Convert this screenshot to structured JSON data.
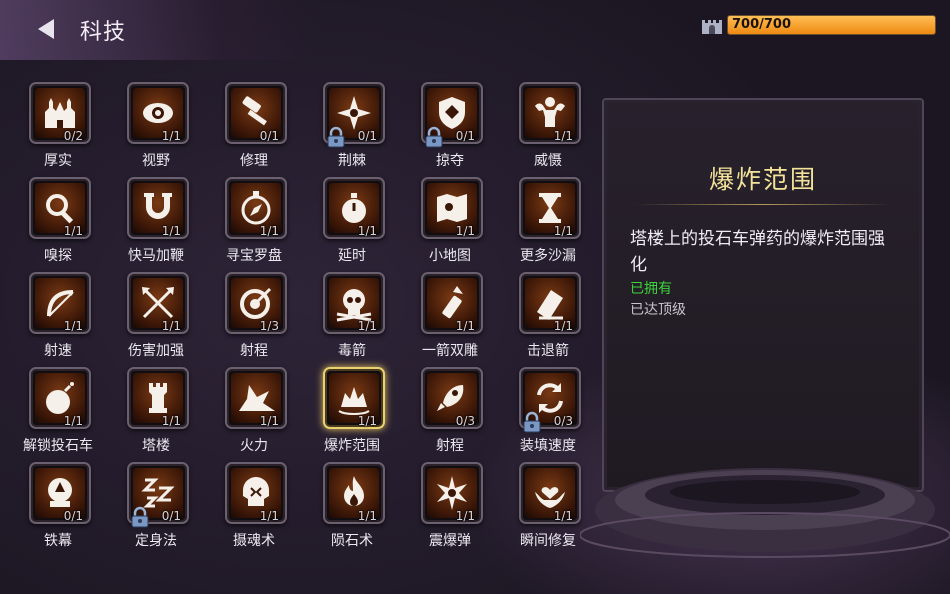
{
  "header": {
    "title": "科技",
    "hp_text": "700/700",
    "hp_fraction": 1.0
  },
  "colors": {
    "accent": "#ee8a12",
    "selected_border": "#e9d070",
    "owned": "#3cd43c",
    "title_gold": "#f3e39a"
  },
  "techs": [
    {
      "name": "厚实",
      "level": "0/2",
      "icon": "castle-icon",
      "locked": false
    },
    {
      "name": "视野",
      "level": "1/1",
      "icon": "eye-icon",
      "locked": false
    },
    {
      "name": "修理",
      "level": "0/1",
      "icon": "hammer-icon",
      "locked": false
    },
    {
      "name": "荆棘",
      "level": "0/1",
      "icon": "thorn-star-icon",
      "locked": true
    },
    {
      "name": "掠夺",
      "level": "0/1",
      "icon": "shield-icon",
      "locked": true
    },
    {
      "name": "威慑",
      "level": "1/1",
      "icon": "strongman-icon",
      "locked": false
    },
    {
      "name": "嗅探",
      "level": "1/1",
      "icon": "magnifier-icon",
      "locked": false
    },
    {
      "name": "快马加鞭",
      "level": "1/1",
      "icon": "horseshoe-icon",
      "locked": false
    },
    {
      "name": "寻宝罗盘",
      "level": "1/1",
      "icon": "compass-icon",
      "locked": false
    },
    {
      "name": "延时",
      "level": "1/1",
      "icon": "stopwatch-icon",
      "locked": false
    },
    {
      "name": "小地图",
      "level": "1/1",
      "icon": "map-icon",
      "locked": false
    },
    {
      "name": "更多沙漏",
      "level": "1/1",
      "icon": "hourglass-icon",
      "locked": false
    },
    {
      "name": "射速",
      "level": "1/1",
      "icon": "bow-icon",
      "locked": false
    },
    {
      "name": "伤害加强",
      "level": "1/1",
      "icon": "crossed-arrows-icon",
      "locked": false
    },
    {
      "name": "射程",
      "level": "1/3",
      "icon": "target-icon",
      "locked": false
    },
    {
      "name": "毒箭",
      "level": "1/1",
      "icon": "skull-icon",
      "locked": false
    },
    {
      "name": "一箭双雕",
      "level": "1/1",
      "icon": "arrow-quiver-icon",
      "locked": false
    },
    {
      "name": "击退箭",
      "level": "1/1",
      "icon": "knockback-arrow-icon",
      "locked": false
    },
    {
      "name": "解锁投石车",
      "level": "1/1",
      "icon": "bomb-icon",
      "locked": false
    },
    {
      "name": "塔楼",
      "level": "1/1",
      "icon": "tower-icon",
      "locked": false
    },
    {
      "name": "火力",
      "level": "1/1",
      "icon": "burst-icon",
      "locked": false
    },
    {
      "name": "爆炸范围",
      "level": "1/1",
      "icon": "explosion-icon",
      "locked": false,
      "selected": true
    },
    {
      "name": "射程",
      "level": "0/3",
      "icon": "rocket-icon",
      "locked": false
    },
    {
      "name": "装填速度",
      "level": "0/3",
      "icon": "reload-icon",
      "locked": true
    },
    {
      "name": "铁幕",
      "level": "0/1",
      "icon": "snow-globe-icon",
      "locked": false
    },
    {
      "name": "定身法",
      "level": "0/1",
      "icon": "sleep-icon",
      "locked": true
    },
    {
      "name": "摄魂术",
      "level": "1/1",
      "icon": "ghost-skull-icon",
      "locked": false
    },
    {
      "name": "陨石术",
      "level": "1/1",
      "icon": "fire-icon",
      "locked": false
    },
    {
      "name": "震爆弹",
      "level": "1/1",
      "icon": "flash-icon",
      "locked": false
    },
    {
      "name": "瞬间修复",
      "level": "1/1",
      "icon": "heart-hands-icon",
      "locked": false
    }
  ],
  "detail": {
    "title": "爆炸范围",
    "description": "塔楼上的投石车弹药的爆炸范围强化",
    "owned_label": "已拥有",
    "max_label": "已达顶级"
  }
}
